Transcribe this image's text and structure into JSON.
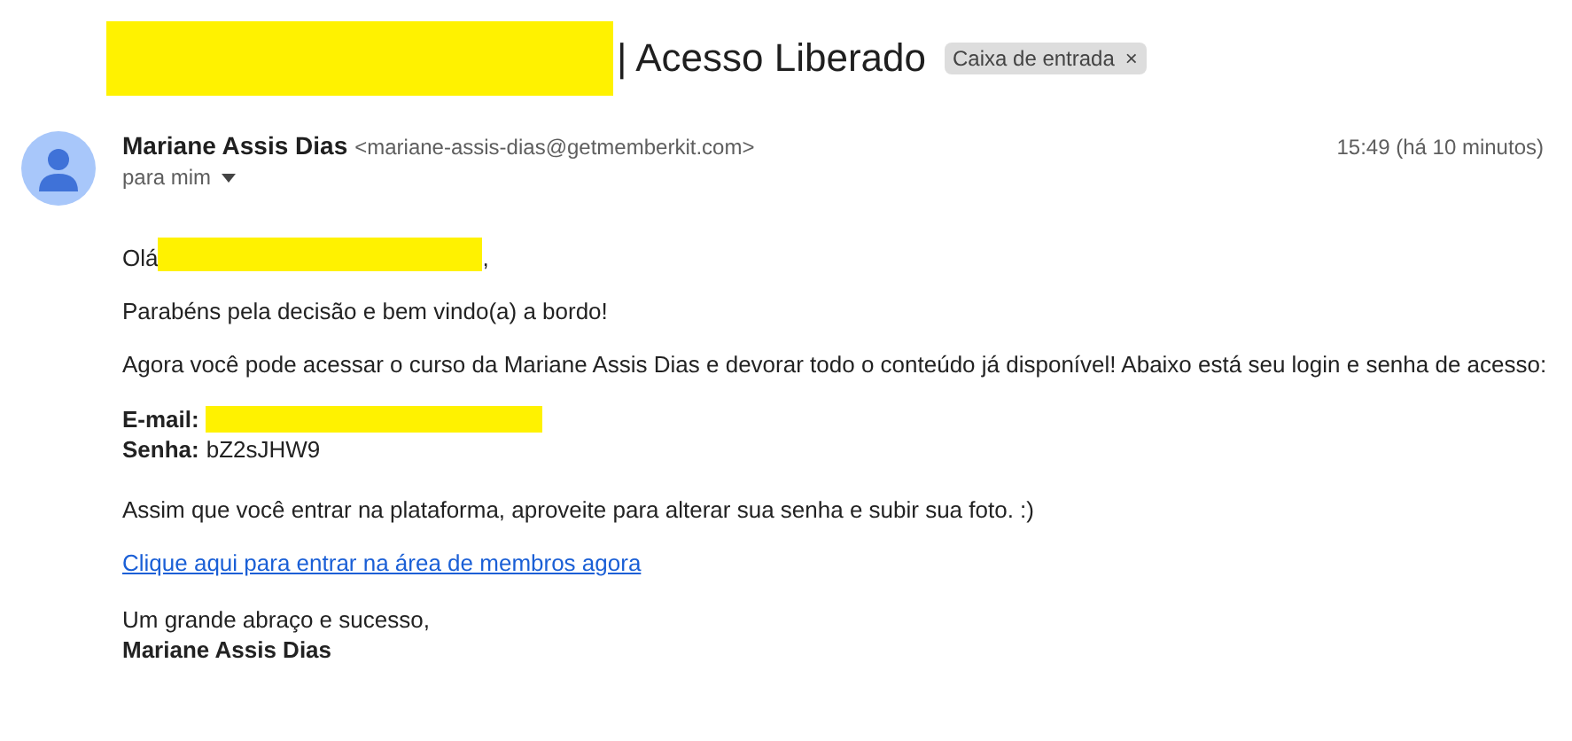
{
  "subject": {
    "title": "| Acesso Liberado",
    "label": "Caixa de entrada",
    "label_close": "×"
  },
  "message": {
    "sender_name": "Mariane Assis Dias",
    "sender_email": "<mariane-assis-dias@getmemberkit.com>",
    "time": "15:49 (há 10 minutos)",
    "recipient": "para mim"
  },
  "body": {
    "greeting": "Olá",
    "greeting_end": ",",
    "paragraphs": [
      "Parabéns pela decisão e bem vindo(a) a bordo!",
      "Agora você pode acessar o curso da Mariane Assis Dias e devorar todo o conteúdo já disponível! Abaixo está seu login e senha de acesso:"
    ],
    "credentials": [
      {
        "label": "E-mail:"
      },
      {
        "label": "Senha:",
        "value": "bZ2sJHW9"
      }
    ],
    "note": "Assim que você entrar na plataforma, aproveite para alterar sua senha e subir sua foto. :)",
    "link": "Clique aqui para entrar na área de membros agora",
    "closing": "Um grande abraço e sucesso,",
    "signature": "Mariane Assis Dias"
  }
}
